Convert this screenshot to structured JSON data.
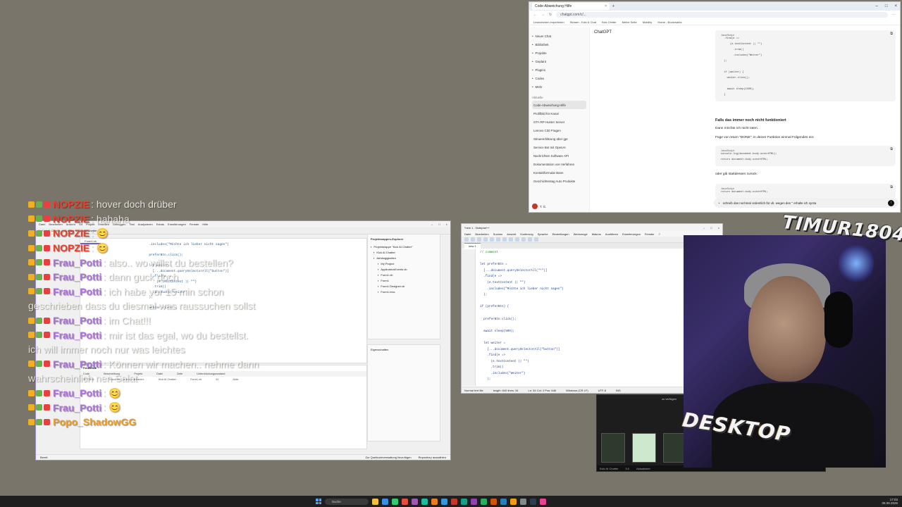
{
  "browser": {
    "tab_title": "Code-Abweichung Hilfe",
    "url": "chatgpt.com/c/...",
    "bookmarks": [
      "Lesezeichen importieren",
      "Stream - Kick & Chat",
      "Kick Center",
      "Meine Seite",
      "Mobility",
      "Home - Bookmarks"
    ],
    "app_name": "ChatGPT",
    "share_label": "Teilen",
    "side_items": [
      "Neuer Chat",
      "Bibliothek",
      "Projekte",
      "Geplant",
      "Plugins",
      "Codex",
      "Mehr"
    ],
    "section_label": "Aktuelle",
    "chats": [
      "Code-Abweichung Hilfe",
      "Profilbild für Kanal",
      "GTA RP Hunter Server",
      "Lenovo C30 Fragen",
      "Steuererklärung über gpt",
      "Service Bot mit OpenAI",
      "Nachrichten Software API",
      "Dokumentation von Verfahren",
      "Kontaktformular Bann",
      "Geschichtentag Auto Produkte"
    ],
    "user_label": "T. G.",
    "code1": {
      "lang": "JavaScript",
      "lines": [
        "  .find(e =>",
        "      (e.textContent || \"\")",
        "        .trim()",
        "        .includes(\"Weiter\")",
        "  );",
        "",
        "  if (weiter) {",
        "    weiter.click();",
        "",
        "    await sleep(1500);",
        "  }"
      ]
    },
    "heading": "Falls das immer noch nicht funktioniert",
    "p1": "Dann möchte ich nicht raten.",
    "p2": "Füge vor return \"DONE\"; in deiner Funktion einmal Folgendes ein:",
    "code2": {
      "lang": "JavaScript",
      "lines": [
        "console.log(document.body.outerHTML);",
        "return document.body.outerHTML;"
      ]
    },
    "p3": "oder gib stattdessen zurück:",
    "code3": {
      "lang": "JavaScript",
      "lines": [
        "return document.body.outerHTML;"
      ]
    },
    "composer_text": "schreib das nochmal ordentlich für vb. wegen den \" erhalte ich synta"
  },
  "ide": {
    "title_items": [
      "Datei",
      "Bearbeiten",
      "Ansicht",
      "Git",
      "Projekt",
      "Erstellen",
      "Debuggen",
      "Test",
      "Analysieren",
      "Extras",
      "Erweiterungen",
      "Fenster",
      "Hilfe"
    ],
    "search_label": "Suchen",
    "project_name": "Kick AI Chatter",
    "run_label": "Kick AI Chatter",
    "file_tab": "Form1.vb",
    "code_lines": [
      "  .includes(\"Möchte ich lieber nicht sagen\")",
      "",
      "  preferBtn.click();",
      "",
      "  let weiter =",
      "    [...document.querySelectorAll(\"button\")]",
      "    .find(e =>",
      "      (e.textContent || \"\")",
      "    .trim()",
      "    .includes(\"Weiter\")",
      "  );",
      "",
      "  weiter.click();"
    ],
    "explorer_title": "Projektmappen-Explorer",
    "explorer_nodes": [
      "Projektmappe \"Kick AI Chatter\"",
      "Kick AI Chatter",
      "Abhängigkeiten",
      "My Project",
      "ApplicationEvents.vb",
      "Form1.vb",
      "Form1",
      "Form1.Designer.vb",
      "Form1.resx"
    ],
    "props_title": "Eigenschaften",
    "errors_title": "Fehlerliste",
    "error_cols": [
      "Code",
      "Beschreibung",
      "Projekt",
      "Datei",
      "Zeile",
      "Unterdrückungszustand"
    ],
    "error_rows": [
      [
        "BC30451",
        "\"document\" ist nicht deklariert.",
        "Kick AI Chatter",
        "Form1.vb",
        "31",
        "Aktiv"
      ]
    ],
    "status_left": "Bereit",
    "status_right": "Zur Quellcodeverwaltung hinzufügen",
    "status_repo": "Repository auswählen"
  },
  "npp": {
    "title": "*new 1 - Notepad++",
    "menu": [
      "Datei",
      "Bearbeiten",
      "Suchen",
      "Ansicht",
      "Kodierung",
      "Sprache",
      "Einstellungen",
      "Werkzeuge",
      "Makros",
      "Ausführen",
      "Erweiterungen",
      "Fenster",
      "?"
    ],
    "tab": "new 1",
    "lines": [
      "// comment",
      "",
      "let preferBtn =",
      "  [...document.querySelectorAll(\"*\")]",
      "  .find(e =>",
      "    (e.textContent || \"\")",
      "    .includes(\"Möchte ich lieber nicht sagen\")",
      "  );",
      "",
      "if (preferBtn) {",
      "",
      "  preferBtn.click();",
      "",
      "  await sleep(500);",
      "",
      "  let weiter =",
      "    [...document.querySelectorAll(\"button\")]",
      "    .find(e =>",
      "      (e.textContent || \"\")",
      "      .trim()",
      "      .includes(\"Weiter\")",
      "    );",
      "",
      "  if (weiter) {",
      "    weiter.click();",
      "",
      "    await sleep(1500);",
      "  }",
      "}"
    ],
    "status": [
      "Normal text file",
      "length: 645  lines: 34",
      "Ln: 34  Col: 2  Pos: 646",
      "Windows (CR LF)",
      "UTF-8",
      "INS"
    ]
  },
  "dark_app": {
    "label": "zu verfügen",
    "bar": [
      "Kick AI Chatter",
      "5.0",
      "Aktualisiert"
    ]
  },
  "overlay": {
    "logo_top": "TIMUR1804",
    "logo_bottom": "DESKTOP"
  },
  "chat_messages": [
    {
      "user": "NOPZIE",
      "color": "#e8402a",
      "text": ": hover doch drüber"
    },
    {
      "user": "NOPZIE",
      "color": "#e8402a",
      "text": ": hahaha"
    },
    {
      "user": "NOPZIE",
      "color": "#e8402a",
      "text": ": 😊"
    },
    {
      "user": "NOPZIE",
      "color": "#e8402a",
      "text": ": 😊"
    },
    {
      "user": "Frau_Potti",
      "color": "#b070e0",
      "text": ": also.. wo willst du bestellen?"
    },
    {
      "user": "Frau_Potti",
      "color": "#b070e0",
      "text": ": dann guck doch"
    },
    {
      "user": "Frau_Potti",
      "color": "#b070e0",
      "text": ": ich habe vor 15 min schon"
    },
    {
      "user": "",
      "color": "",
      "text": "geschrieben dass du diesmal was raussuchen sollst"
    },
    {
      "user": "Frau_Potti",
      "color": "#b070e0",
      "text": ": im Chat!!!"
    },
    {
      "user": "Frau_Potti",
      "color": "#b070e0",
      "text": ": mir ist das egal, wo du bestellst."
    },
    {
      "user": "",
      "color": "",
      "text": "ich will immer noch nur was leichtes"
    },
    {
      "user": "Frau_Potti",
      "color": "#b070e0",
      "text": ": Können wir machen.. nehme dann"
    },
    {
      "user": "",
      "color": "",
      "text": "wahrscheinlich nen Salat"
    },
    {
      "user": "Frau_Potti",
      "color": "#b070e0",
      "text": ": 😊"
    },
    {
      "user": "Frau_Potti",
      "color": "#b070e0",
      "text": ": 😊"
    },
    {
      "user": "Popo_ShadowGG",
      "color": "#f0a020",
      "text": ""
    }
  ],
  "taskbar": {
    "search_placeholder": "Suche",
    "apps": [
      "#f0c040",
      "#3a8ee6",
      "#2ecc71",
      "#e74c3c",
      "#9b59b6",
      "#1abc9c",
      "#e67e22",
      "#3498db",
      "#c0392b",
      "#16a085",
      "#8e44ad",
      "#27ae60",
      "#d35400",
      "#2980b9",
      "#f39c12",
      "#7f8c8d",
      "#2c3e50",
      "#e84393"
    ],
    "time": "17:03",
    "date": "05.08.2025"
  }
}
